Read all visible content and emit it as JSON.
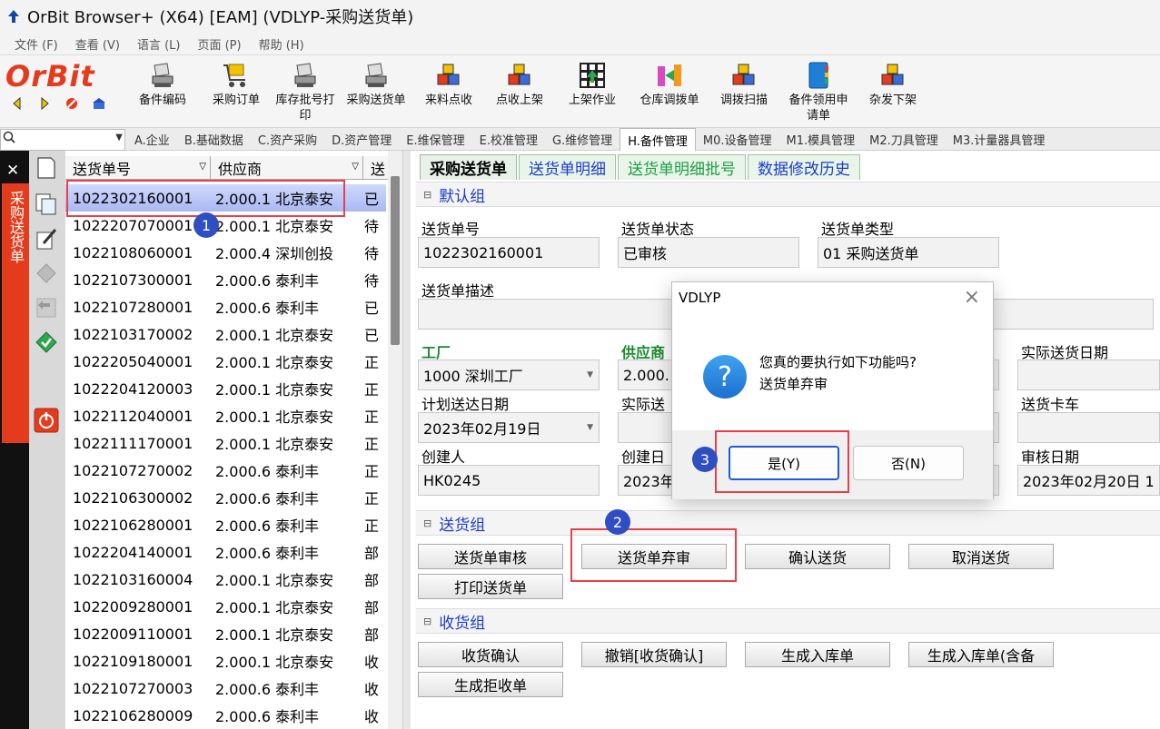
{
  "window": {
    "title": "OrBit Browser+ (X64) [EAM] (VDLYP-采购送货单)"
  },
  "menu": [
    "文件 (F)",
    "查看 (V)",
    "语言 (L)",
    "页面 (P)",
    "帮助 (H)"
  ],
  "logo": {
    "text": "OrBit"
  },
  "toolbar": [
    {
      "label": "备件编码",
      "icon": "stamp-icon"
    },
    {
      "label": "采购订单",
      "icon": "cart-icon"
    },
    {
      "label": "库存批号打\n印",
      "icon": "stamp-icon"
    },
    {
      "label": "采购送货单",
      "icon": "stamp-icon"
    },
    {
      "label": "来料点收",
      "icon": "cubes-icon"
    },
    {
      "label": "点收上架",
      "icon": "cubes-icon"
    },
    {
      "label": "上架作业",
      "icon": "grid-icon"
    },
    {
      "label": "仓库调拨单",
      "icon": "transfer-icon"
    },
    {
      "label": "调拨扫描",
      "icon": "cubes-icon"
    },
    {
      "label": "备件领用申\n请单",
      "icon": "book-icon"
    },
    {
      "label": "杂发下架",
      "icon": "cubes-icon"
    }
  ],
  "module_tabs": [
    {
      "label": "A.企业",
      "active": false
    },
    {
      "label": "B.基础数据",
      "active": false
    },
    {
      "label": "C.资产采购",
      "active": false
    },
    {
      "label": "D.资产管理",
      "active": false
    },
    {
      "label": "E.维保管理",
      "active": false
    },
    {
      "label": "E.校准管理",
      "active": false
    },
    {
      "label": "G.维修管理",
      "active": false
    },
    {
      "label": "H.备件管理",
      "active": true
    },
    {
      "label": "M0.设备管理",
      "active": false
    },
    {
      "label": "M1.模具管理",
      "active": false
    },
    {
      "label": "M2.刀具管理",
      "active": false
    },
    {
      "label": "M3.计量器具管理",
      "active": false
    }
  ],
  "vertical_tab": {
    "label": "采购送货单"
  },
  "list": {
    "headers": [
      "送货单号",
      "供应商",
      "送"
    ],
    "rows": [
      [
        "1022302160001",
        "2.000.1 北京泰安",
        "已"
      ],
      [
        "1022207070001",
        "2.000.1 北京泰安",
        "待"
      ],
      [
        "1022108060001",
        "2.000.4 深圳创投",
        "待"
      ],
      [
        "1022107300001",
        "2.000.6 泰利丰",
        "待"
      ],
      [
        "1022107280001",
        "2.000.6 泰利丰",
        "已"
      ],
      [
        "1022103170002",
        "2.000.1 北京泰安",
        "已"
      ],
      [
        "1022205040001",
        "2.000.1 北京泰安",
        "正"
      ],
      [
        "1022204120003",
        "2.000.1 北京泰安",
        "正"
      ],
      [
        "1022112040001",
        "2.000.1 北京泰安",
        "正"
      ],
      [
        "1022111170001",
        "2.000.1 北京泰安",
        "正"
      ],
      [
        "1022107270002",
        "2.000.6 泰利丰",
        "正"
      ],
      [
        "1022106300002",
        "2.000.6 泰利丰",
        "正"
      ],
      [
        "1022106280001",
        "2.000.6 泰利丰",
        "正"
      ],
      [
        "1022204140001",
        "2.000.6 泰利丰",
        "部"
      ],
      [
        "1022103160004",
        "2.000.1 北京泰安",
        "部"
      ],
      [
        "1022009280001",
        "2.000.1 北京泰安",
        "部"
      ],
      [
        "1022009110001",
        "2.000.1 北京泰安",
        "部"
      ],
      [
        "1022109180001",
        "2.000.1 北京泰安",
        "收"
      ],
      [
        "1022107270003",
        "2.000.6 泰利丰",
        "收"
      ],
      [
        "1022106280009",
        "2.000.6 泰利丰",
        "收"
      ]
    ]
  },
  "detail": {
    "tabs": [
      "采购送货单",
      "送货单明细",
      "送货单明细批号",
      "数据修改历史"
    ],
    "default_group": {
      "title": "默认组",
      "delivery_no_label": "送货单号",
      "delivery_no": "1022302160001",
      "status_label": "送货单状态",
      "status": "已审核",
      "type_label": "送货单类型",
      "type": "01 采购送货单",
      "desc_label": "送货单描述",
      "factory_label": "工厂",
      "factory": "1000 深圳工厂",
      "supplier_label": "供应商",
      "supplier": "2.000.",
      "actual_date_label": "实际送货日期",
      "plan_date_label": "计划送达日期",
      "plan_date": "2023年02月19日",
      "actual_send_label": "实际送",
      "truck_label": "送货卡车",
      "creator_label": "创建人",
      "creator": "HK0245",
      "create_date_label": "创建日",
      "create_date": "2023年",
      "audit_date_label": "审核日期",
      "audit_date": "2023年02月20日 1"
    },
    "delivery_group": {
      "title": "送货组",
      "buttons": [
        "送货单审核",
        "送货单弃审",
        "确认送货",
        "取消送货",
        "打印送货单"
      ]
    },
    "receive_group": {
      "title": "收货组",
      "buttons": [
        "收货确认",
        "撤销[收货确认]",
        "生成入库单",
        "生成入库单(含备",
        "生成拒收单"
      ]
    }
  },
  "dialog": {
    "title": "VDLYP",
    "line1": "您真的要执行如下功能吗?",
    "line2": "送货单弃审",
    "yes": "是(Y)",
    "no": "否(N)"
  },
  "badges": [
    "1",
    "2",
    "3"
  ],
  "colors": {
    "accent_red": "#e53b1d",
    "highlight": "#e8404a",
    "badge": "#2f4ec2"
  }
}
